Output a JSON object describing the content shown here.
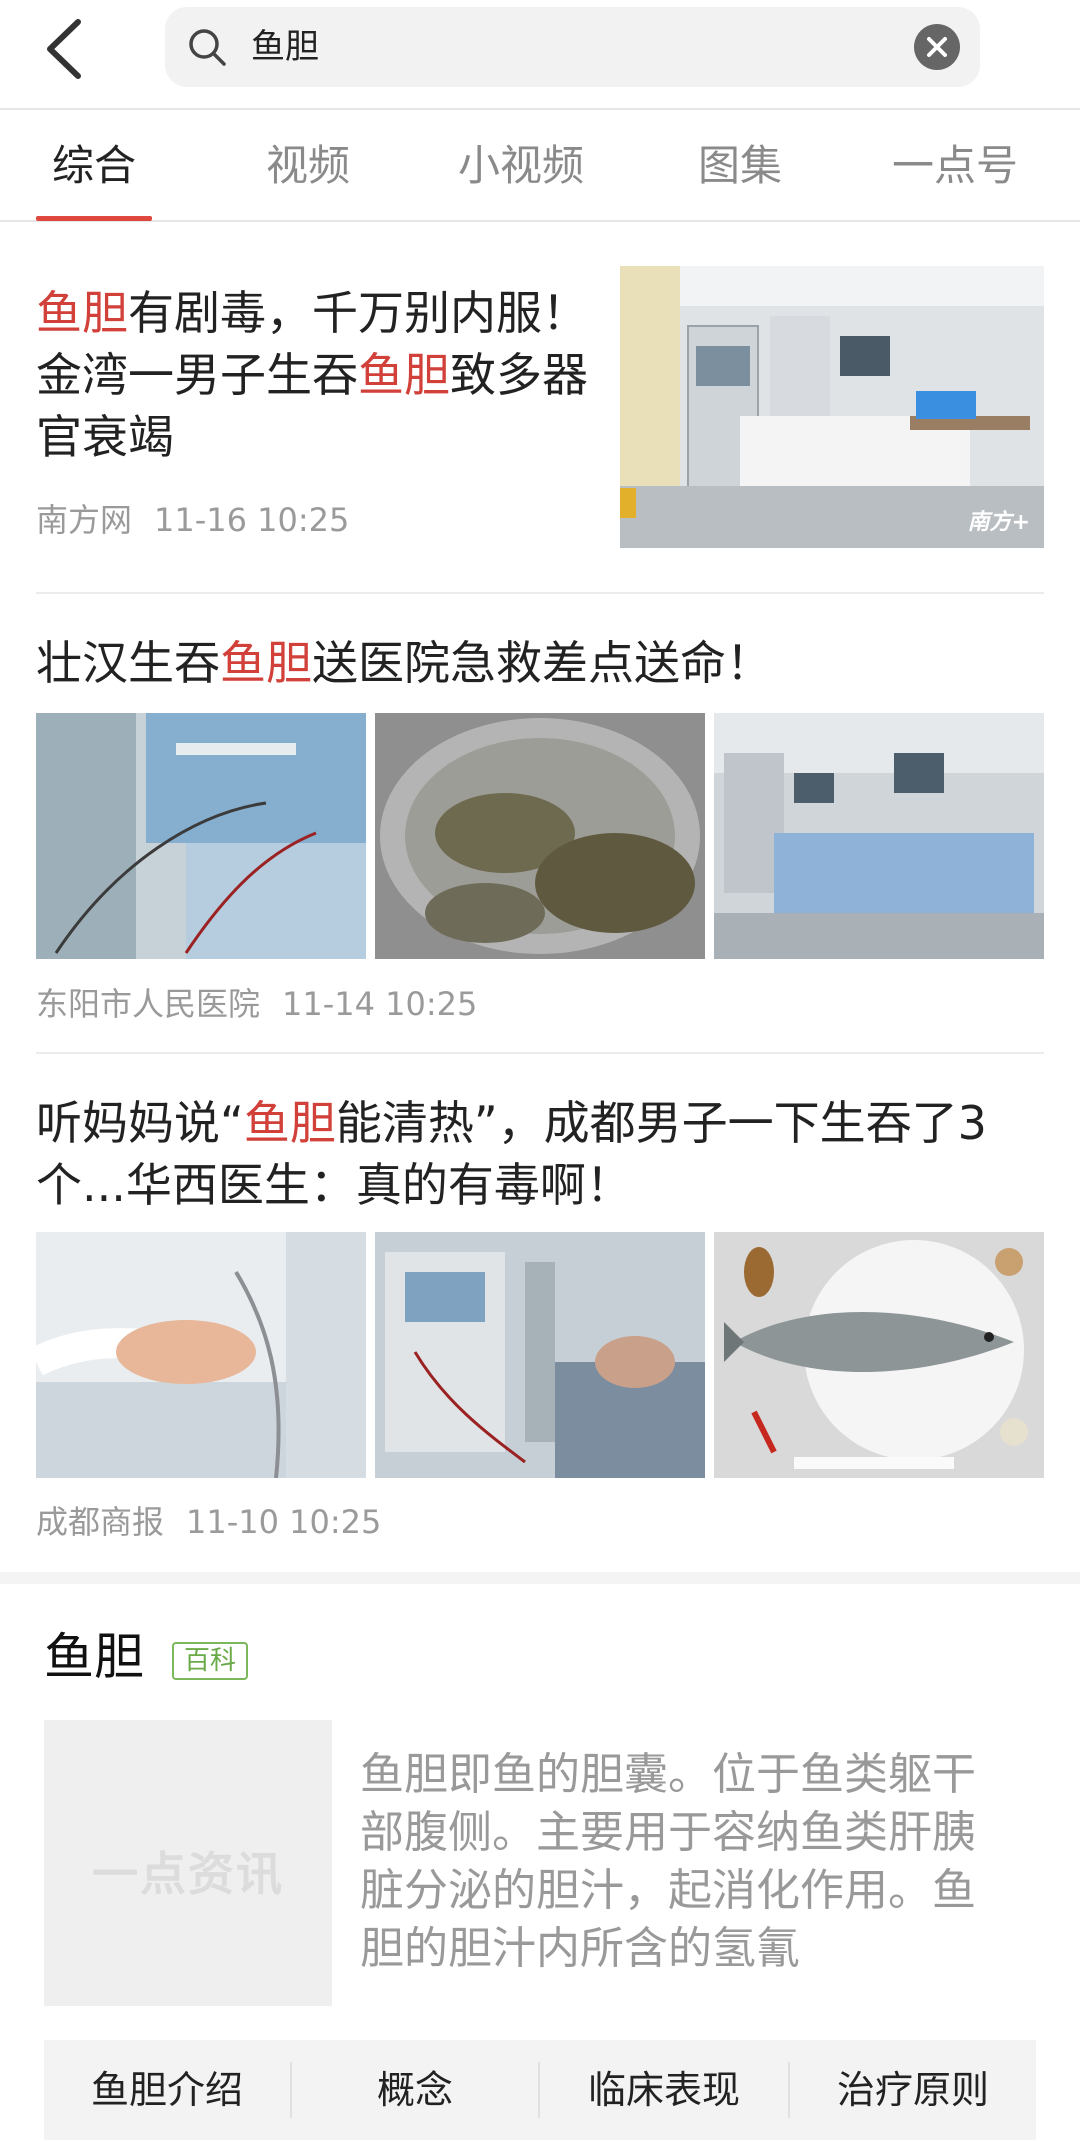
{
  "search": {
    "query": "鱼胆"
  },
  "tabs": [
    {
      "label": "综合"
    },
    {
      "label": "视频"
    },
    {
      "label": "小视频"
    },
    {
      "label": "图集"
    },
    {
      "label": "一点号"
    }
  ],
  "articles": [
    {
      "title_parts": [
        "鱼胆",
        "有剧毒，千万别内服！金湾一男子生吞",
        "鱼胆",
        "致多器官衰竭"
      ],
      "source": "南方网",
      "time": "11-16 10:25",
      "image_watermark": "南方+"
    },
    {
      "title_parts": [
        "壮汉生吞",
        "鱼胆",
        "送医院急救差点送命！"
      ],
      "source": "东阳市人民医院",
      "time": "11-14 10:25"
    },
    {
      "title_parts": [
        "听妈妈说“",
        "鱼胆",
        "能清热”，成都男子一下生吞了3个...华西医生：真的有毒啊！"
      ],
      "source": "成都商报",
      "time": "11-10 10:25"
    }
  ],
  "wiki": {
    "title": "鱼胆",
    "badge": "百科",
    "thumb_watermark": "一点资讯",
    "description": "鱼胆即鱼的胆囊。位于鱼类躯干部腹侧。主要用于容纳鱼类肝胰脏分泌的胆汁，起消化作用。鱼胆的胆汁内所含的氢氰",
    "links": [
      {
        "label": "鱼胆介绍"
      },
      {
        "label": "概念"
      },
      {
        "label": "临床表现"
      },
      {
        "label": "治疗原则"
      }
    ]
  },
  "colors": {
    "accent": "#d2403a",
    "badge_green": "#6aaa48"
  }
}
